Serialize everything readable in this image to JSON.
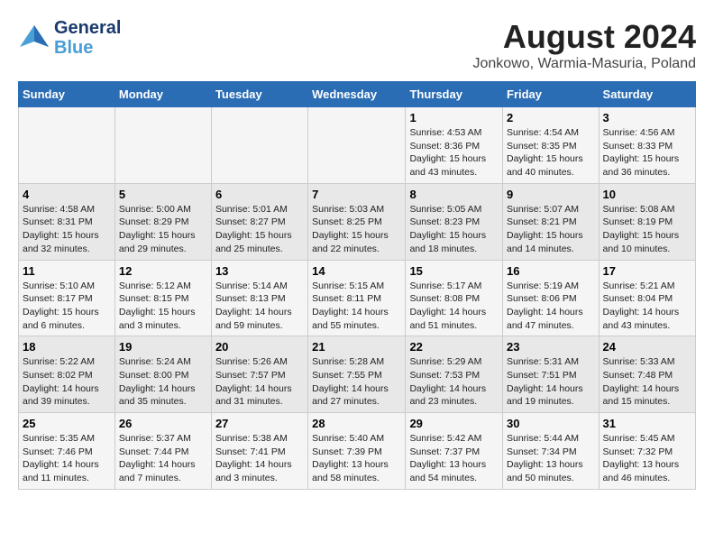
{
  "header": {
    "logo_line1": "General",
    "logo_line2": "Blue",
    "month": "August 2024",
    "location": "Jonkowo, Warmia-Masuria, Poland"
  },
  "weekdays": [
    "Sunday",
    "Monday",
    "Tuesday",
    "Wednesday",
    "Thursday",
    "Friday",
    "Saturday"
  ],
  "weeks": [
    [
      {
        "day": "",
        "info": ""
      },
      {
        "day": "",
        "info": ""
      },
      {
        "day": "",
        "info": ""
      },
      {
        "day": "",
        "info": ""
      },
      {
        "day": "1",
        "info": "Sunrise: 4:53 AM\nSunset: 8:36 PM\nDaylight: 15 hours\nand 43 minutes."
      },
      {
        "day": "2",
        "info": "Sunrise: 4:54 AM\nSunset: 8:35 PM\nDaylight: 15 hours\nand 40 minutes."
      },
      {
        "day": "3",
        "info": "Sunrise: 4:56 AM\nSunset: 8:33 PM\nDaylight: 15 hours\nand 36 minutes."
      }
    ],
    [
      {
        "day": "4",
        "info": "Sunrise: 4:58 AM\nSunset: 8:31 PM\nDaylight: 15 hours\nand 32 minutes."
      },
      {
        "day": "5",
        "info": "Sunrise: 5:00 AM\nSunset: 8:29 PM\nDaylight: 15 hours\nand 29 minutes."
      },
      {
        "day": "6",
        "info": "Sunrise: 5:01 AM\nSunset: 8:27 PM\nDaylight: 15 hours\nand 25 minutes."
      },
      {
        "day": "7",
        "info": "Sunrise: 5:03 AM\nSunset: 8:25 PM\nDaylight: 15 hours\nand 22 minutes."
      },
      {
        "day": "8",
        "info": "Sunrise: 5:05 AM\nSunset: 8:23 PM\nDaylight: 15 hours\nand 18 minutes."
      },
      {
        "day": "9",
        "info": "Sunrise: 5:07 AM\nSunset: 8:21 PM\nDaylight: 15 hours\nand 14 minutes."
      },
      {
        "day": "10",
        "info": "Sunrise: 5:08 AM\nSunset: 8:19 PM\nDaylight: 15 hours\nand 10 minutes."
      }
    ],
    [
      {
        "day": "11",
        "info": "Sunrise: 5:10 AM\nSunset: 8:17 PM\nDaylight: 15 hours\nand 6 minutes."
      },
      {
        "day": "12",
        "info": "Sunrise: 5:12 AM\nSunset: 8:15 PM\nDaylight: 15 hours\nand 3 minutes."
      },
      {
        "day": "13",
        "info": "Sunrise: 5:14 AM\nSunset: 8:13 PM\nDaylight: 14 hours\nand 59 minutes."
      },
      {
        "day": "14",
        "info": "Sunrise: 5:15 AM\nSunset: 8:11 PM\nDaylight: 14 hours\nand 55 minutes."
      },
      {
        "day": "15",
        "info": "Sunrise: 5:17 AM\nSunset: 8:08 PM\nDaylight: 14 hours\nand 51 minutes."
      },
      {
        "day": "16",
        "info": "Sunrise: 5:19 AM\nSunset: 8:06 PM\nDaylight: 14 hours\nand 47 minutes."
      },
      {
        "day": "17",
        "info": "Sunrise: 5:21 AM\nSunset: 8:04 PM\nDaylight: 14 hours\nand 43 minutes."
      }
    ],
    [
      {
        "day": "18",
        "info": "Sunrise: 5:22 AM\nSunset: 8:02 PM\nDaylight: 14 hours\nand 39 minutes."
      },
      {
        "day": "19",
        "info": "Sunrise: 5:24 AM\nSunset: 8:00 PM\nDaylight: 14 hours\nand 35 minutes."
      },
      {
        "day": "20",
        "info": "Sunrise: 5:26 AM\nSunset: 7:57 PM\nDaylight: 14 hours\nand 31 minutes."
      },
      {
        "day": "21",
        "info": "Sunrise: 5:28 AM\nSunset: 7:55 PM\nDaylight: 14 hours\nand 27 minutes."
      },
      {
        "day": "22",
        "info": "Sunrise: 5:29 AM\nSunset: 7:53 PM\nDaylight: 14 hours\nand 23 minutes."
      },
      {
        "day": "23",
        "info": "Sunrise: 5:31 AM\nSunset: 7:51 PM\nDaylight: 14 hours\nand 19 minutes."
      },
      {
        "day": "24",
        "info": "Sunrise: 5:33 AM\nSunset: 7:48 PM\nDaylight: 14 hours\nand 15 minutes."
      }
    ],
    [
      {
        "day": "25",
        "info": "Sunrise: 5:35 AM\nSunset: 7:46 PM\nDaylight: 14 hours\nand 11 minutes."
      },
      {
        "day": "26",
        "info": "Sunrise: 5:37 AM\nSunset: 7:44 PM\nDaylight: 14 hours\nand 7 minutes."
      },
      {
        "day": "27",
        "info": "Sunrise: 5:38 AM\nSunset: 7:41 PM\nDaylight: 14 hours\nand 3 minutes."
      },
      {
        "day": "28",
        "info": "Sunrise: 5:40 AM\nSunset: 7:39 PM\nDaylight: 13 hours\nand 58 minutes."
      },
      {
        "day": "29",
        "info": "Sunrise: 5:42 AM\nSunset: 7:37 PM\nDaylight: 13 hours\nand 54 minutes."
      },
      {
        "day": "30",
        "info": "Sunrise: 5:44 AM\nSunset: 7:34 PM\nDaylight: 13 hours\nand 50 minutes."
      },
      {
        "day": "31",
        "info": "Sunrise: 5:45 AM\nSunset: 7:32 PM\nDaylight: 13 hours\nand 46 minutes."
      }
    ]
  ]
}
